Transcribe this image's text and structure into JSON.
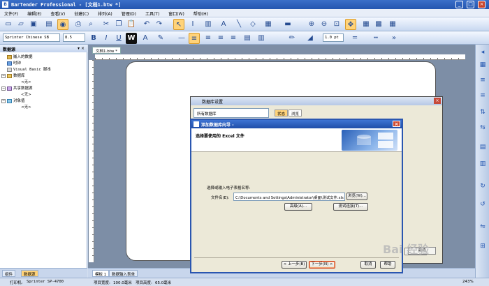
{
  "window": {
    "title": "BarTender Professional - [文档1.btw *]",
    "app_icon": "bartender-icon",
    "controls": [
      "_",
      "□",
      "×"
    ]
  },
  "menu": [
    "文件(F)",
    "编辑(E)",
    "查看(V)",
    "创建(C)",
    "排列(A)",
    "管理(D)",
    "工具(T)",
    "窗口(W)",
    "帮助(H)"
  ],
  "format_toolbar": {
    "font_name": "Sprinter Chinese SB",
    "font_size": "8.5",
    "line_width": "1.0 pt"
  },
  "left_panel": {
    "title": "数据源",
    "pin": "▾ ×",
    "tree": [
      {
        "label": "嵌入的数据",
        "level": 1,
        "icon": "folder-icon"
      },
      {
        "label": "时钟",
        "level": 1,
        "icon": "clock-icon"
      },
      {
        "label": "Visual Basic 脚本",
        "level": 1,
        "icon": "script-icon"
      },
      {
        "label": "数据库",
        "level": 0,
        "toggle": "⊟",
        "icon": "database-icon"
      },
      {
        "label": "<无>",
        "level": 2,
        "icon": ""
      },
      {
        "label": "共享数据源",
        "level": 0,
        "toggle": "⊟",
        "icon": "shared-icon"
      },
      {
        "label": "<无>",
        "level": 2,
        "icon": ""
      },
      {
        "label": "对象值",
        "level": 0,
        "toggle": "⊟",
        "icon": "object-icon"
      },
      {
        "label": "<无>",
        "level": 2,
        "icon": ""
      }
    ],
    "tabs": [
      "组件",
      "数据源"
    ]
  },
  "document": {
    "tab": "文档1.btw *",
    "bottom_tabs": [
      "模板 1",
      "数据输入表单"
    ]
  },
  "status": {
    "printer_label": "打印机:",
    "printer": "Sprinter SP-4700",
    "width_label": "项目宽度:",
    "width": "100.0毫米",
    "height_label": "项目高度:",
    "height": "65.0毫米",
    "zoom": "243%"
  },
  "db_dialog": {
    "title": "数据库设置",
    "tree_root": "所有数据库",
    "tabs": [
      "状态",
      "浏览"
    ],
    "buttons": [
      "确定",
      "取消"
    ]
  },
  "wizard": {
    "title": "添加数据库向导 -",
    "heading": "选择要使用的 Excel 文件",
    "prompt": "选择或输入电子表格名称:",
    "file_label": "文件名(E):",
    "file_value": "C:\\Documents and Settings\\Administrator\\桌面\\测试文件.xls",
    "browse": "浏览(W)...",
    "advanced": "高级(A)...",
    "test": "测试连接(T)...",
    "back": "< 上一步(B)",
    "next": "下一步(N) >",
    "cancel": "取消",
    "help": "帮助"
  },
  "watermark": "Bai 经验"
}
